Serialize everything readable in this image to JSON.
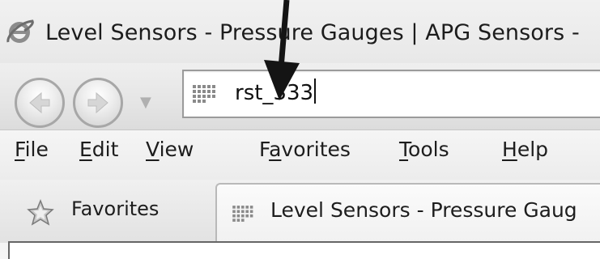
{
  "window": {
    "title": "Level Sensors - Pressure Gauges | APG Sensors -",
    "icon": "internet-explorer-icon"
  },
  "navigation": {
    "back_icon": "back-arrow-icon",
    "forward_icon": "forward-arrow-icon",
    "recent_pages_icon": "chevron-down-icon",
    "address_value": "rst_333",
    "address_icon": "site-favicon-grid-icon"
  },
  "menu": {
    "items": [
      {
        "mnemonic": "F",
        "rest": "ile"
      },
      {
        "mnemonic": "E",
        "rest": "dit"
      },
      {
        "mnemonic": "V",
        "rest": "iew"
      },
      {
        "prefix": "F",
        "mnemonic": "a",
        "rest": "vorites"
      },
      {
        "mnemonic": "T",
        "rest": "ools"
      },
      {
        "mnemonic": "H",
        "rest": "elp"
      }
    ]
  },
  "favorites_bar": {
    "favorites_label": "Favorites",
    "favorites_icon": "star-icon",
    "tab_label": "Level Sensors - Pressure Gaug",
    "tab_icon": "site-favicon-grid-icon"
  },
  "annotation": {
    "pointer_icon": "down-arrow-annotation"
  }
}
